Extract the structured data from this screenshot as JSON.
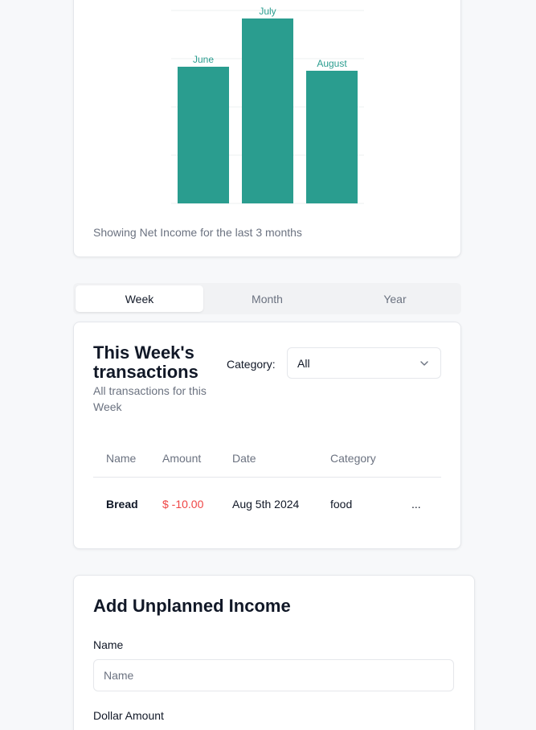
{
  "chart": {
    "caption": "Showing Net Income for the last 3 months",
    "bar_color": "#2a9d8f"
  },
  "chart_data": {
    "type": "bar",
    "categories": [
      "June",
      "July",
      "August"
    ],
    "values": [
      170,
      230,
      165
    ],
    "ylim": [
      0,
      240
    ],
    "grid": true,
    "title": "",
    "xlabel": "",
    "ylabel": ""
  },
  "tabs": [
    {
      "label": "Week",
      "active": true
    },
    {
      "label": "Month",
      "active": false
    },
    {
      "label": "Year",
      "active": false
    }
  ],
  "transactions": {
    "title": "This Week's transactions",
    "subtitle": "All transactions for this Week",
    "category_label": "Category:",
    "category_value": "All",
    "columns": [
      "Name",
      "Amount",
      "Date",
      "Category"
    ],
    "rows": [
      {
        "name": "Bread",
        "amount": "$ -10.00",
        "date": "Aug 5th 2024",
        "category": "food",
        "more": "..."
      }
    ]
  },
  "income": {
    "title": "Add Unplanned Income",
    "name_label": "Name",
    "name_placeholder": "Name",
    "amount_label": "Dollar Amount"
  }
}
